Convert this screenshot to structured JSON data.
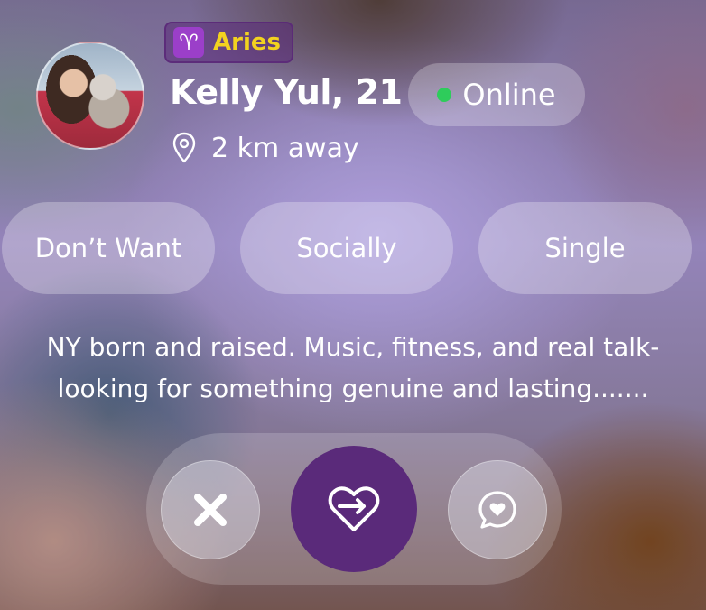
{
  "profile": {
    "zodiac_sign": "Aries",
    "zodiac_symbol": "♈",
    "name_age": "Kelly Yul, 21",
    "status": "Online",
    "distance": "2 km away"
  },
  "tags": [
    "Don’t Want",
    "Socially",
    "Single"
  ],
  "bio": "NY born and raised. Music, fitness, and real talk- looking for something genuine and lasting.......",
  "colors": {
    "zodiac_text": "#f2d21f",
    "online_dot": "#2ecc5b",
    "like_button": "#5a2a7a"
  },
  "actions": {
    "pass_icon": "close-icon",
    "like_icon": "heart-arrow-icon",
    "chat_icon": "chat-heart-icon"
  }
}
